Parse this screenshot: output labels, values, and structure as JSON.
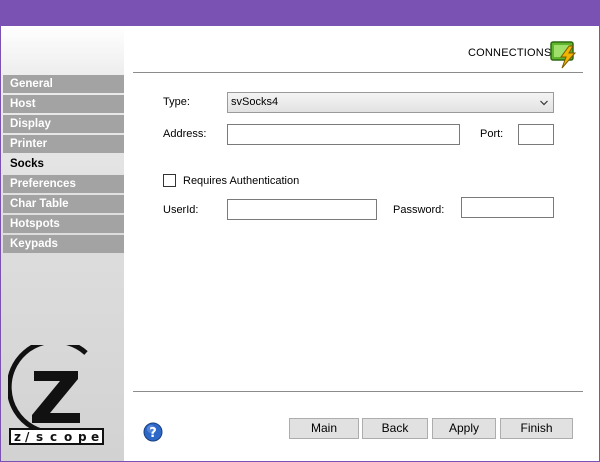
{
  "header": {
    "title": "CONNECTIONS"
  },
  "sidebar": {
    "items": [
      {
        "label": "General"
      },
      {
        "label": "Host"
      },
      {
        "label": "Display"
      },
      {
        "label": "Printer"
      },
      {
        "label": "Socks"
      },
      {
        "label": "Preferences"
      },
      {
        "label": "Char Table"
      },
      {
        "label": "Hotspots"
      },
      {
        "label": "Keypads"
      }
    ],
    "active": "Socks",
    "logo_text": "z/scope"
  },
  "form": {
    "type_label": "Type:",
    "type_value": "svSocks4",
    "address_label": "Address:",
    "address_value": "",
    "port_label": "Port:",
    "port_value": "",
    "requires_auth_label": "Requires Authentication",
    "requires_auth_checked": false,
    "userid_label": "UserId:",
    "userid_value": "",
    "password_label": "Password:",
    "password_value": ""
  },
  "buttons": {
    "main": "Main",
    "back": "Back",
    "apply": "Apply",
    "finish": "Finish"
  },
  "icons": {
    "connections": "lightning-bolt-icon",
    "help": "help-icon"
  },
  "colors": {
    "title_bar": "#7a52b3",
    "nav_item_bg": "#a3a3a3",
    "help_icon": "#2d67c8",
    "connection_icon_green": "#5fb52c",
    "connection_icon_bolt": "#f2b400"
  }
}
